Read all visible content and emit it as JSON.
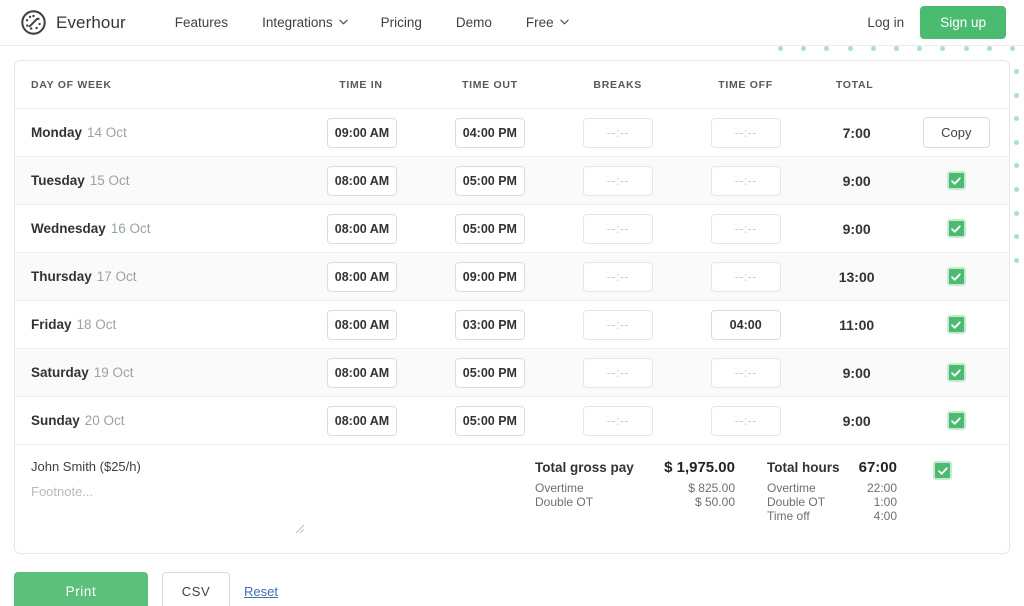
{
  "nav": {
    "brand": "Everhour",
    "brand_icon": "everhour-clock-logo",
    "links": [
      {
        "label": "Features",
        "caret": false
      },
      {
        "label": "Integrations",
        "caret": true
      },
      {
        "label": "Pricing",
        "caret": false
      },
      {
        "label": "Demo",
        "caret": false
      },
      {
        "label": "Free",
        "caret": true
      }
    ],
    "login": "Log in",
    "signup": "Sign up"
  },
  "table": {
    "columns": [
      "DAY OF WEEK",
      "TIME IN",
      "TIME OUT",
      "BREAKS",
      "TIME OFF",
      "TOTAL"
    ],
    "placeholder": "--:--",
    "copy_label": "Copy",
    "rows": [
      {
        "day": "Monday",
        "date": "14 Oct",
        "time_in": "09:00 AM",
        "time_out": "04:00 PM",
        "breaks": "",
        "time_off": "",
        "total": "7:00",
        "action": "copy"
      },
      {
        "day": "Tuesday",
        "date": "15 Oct",
        "time_in": "08:00 AM",
        "time_out": "05:00 PM",
        "breaks": "",
        "time_off": "",
        "total": "9:00",
        "action": "check"
      },
      {
        "day": "Wednesday",
        "date": "16 Oct",
        "time_in": "08:00 AM",
        "time_out": "05:00 PM",
        "breaks": "",
        "time_off": "",
        "total": "9:00",
        "action": "check"
      },
      {
        "day": "Thursday",
        "date": "17 Oct",
        "time_in": "08:00 AM",
        "time_out": "09:00 PM",
        "breaks": "",
        "time_off": "",
        "total": "13:00",
        "action": "check"
      },
      {
        "day": "Friday",
        "date": "18 Oct",
        "time_in": "08:00 AM",
        "time_out": "03:00 PM",
        "breaks": "",
        "time_off": "04:00",
        "total": "11:00",
        "action": "check"
      },
      {
        "day": "Saturday",
        "date": "19 Oct",
        "time_in": "08:00 AM",
        "time_out": "05:00 PM",
        "breaks": "",
        "time_off": "",
        "total": "9:00",
        "action": "check"
      },
      {
        "day": "Sunday",
        "date": "20 Oct",
        "time_in": "08:00 AM",
        "time_out": "05:00 PM",
        "breaks": "",
        "time_off": "",
        "total": "9:00",
        "action": "check"
      }
    ]
  },
  "summary": {
    "employee": "John Smith ($25/h)",
    "footnote_value": "",
    "footnote_placeholder": "Footnote...",
    "pay": {
      "total_label": "Total gross pay",
      "total_value": "$ 1,975.00",
      "lines": [
        {
          "label": "Overtime",
          "value": "$ 825.00"
        },
        {
          "label": "Double OT",
          "value": "$ 50.00"
        }
      ]
    },
    "hours": {
      "total_label": "Total hours",
      "total_value": "67:00",
      "lines": [
        {
          "label": "Overtime",
          "value": "22:00"
        },
        {
          "label": "Double OT",
          "value": "1:00"
        },
        {
          "label": "Time off",
          "value": "4:00"
        }
      ]
    }
  },
  "actions": {
    "print": "Print",
    "csv": "CSV",
    "reset": "Reset"
  },
  "colors": {
    "accent_green": "#4cbb72",
    "print_green": "#5cbf7c",
    "dot_green": "#8fd9a8",
    "link_blue": "#3f6fb5",
    "row_alt": "#fafafa"
  }
}
